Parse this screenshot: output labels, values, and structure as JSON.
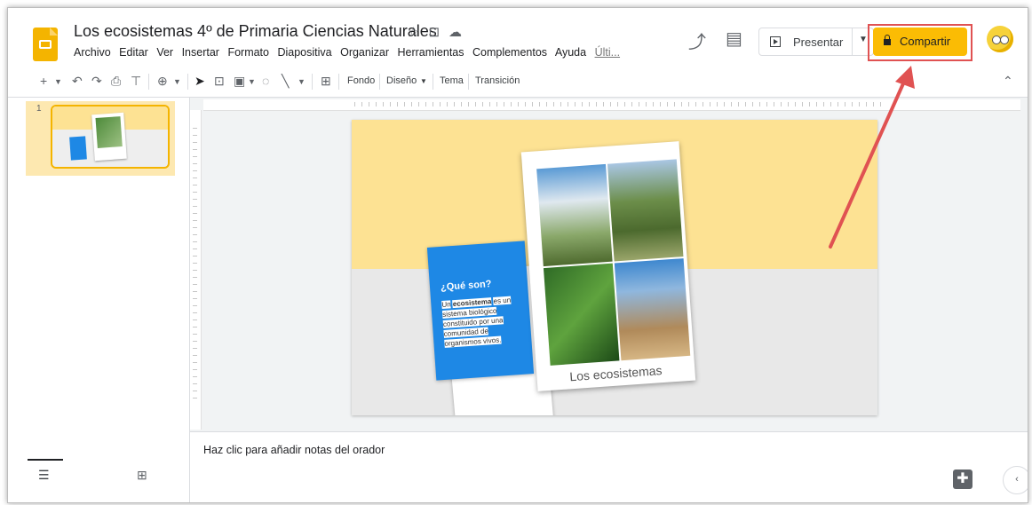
{
  "document": {
    "title": "Los ecosistemas 4º de Primaria Ciencias Naturales",
    "icons": [
      "star-icon",
      "move-to-folder-icon",
      "cloud-status-icon"
    ]
  },
  "menu": {
    "items": [
      "Archivo",
      "Editar",
      "Ver",
      "Insertar",
      "Formato",
      "Diapositiva",
      "Organizar",
      "Herramientas",
      "Complementos",
      "Ayuda"
    ],
    "last_edit": "Últi..."
  },
  "header": {
    "present_label": "Presentar",
    "share_label": "Compartir",
    "accent": "#fbbc04",
    "highlight_color": "#e05252"
  },
  "toolbar": {
    "fondo": "Fondo",
    "diseno": "Diseño",
    "tema": "Tema",
    "transicion": "Transición"
  },
  "filmstrip": {
    "slide_number": "1"
  },
  "slide": {
    "question": "¿Qué son?",
    "definition_bold": "ecosistema",
    "definition_prefix": "Un",
    "definition_rest": "es un sistema biológico constituido por una comunidad de organismos vivos.",
    "caption": "Los ecosistemas",
    "top_color": "#fde293",
    "card_color": "#1e88e5"
  },
  "notes": {
    "placeholder": "Haz clic para añadir notas del orador"
  }
}
